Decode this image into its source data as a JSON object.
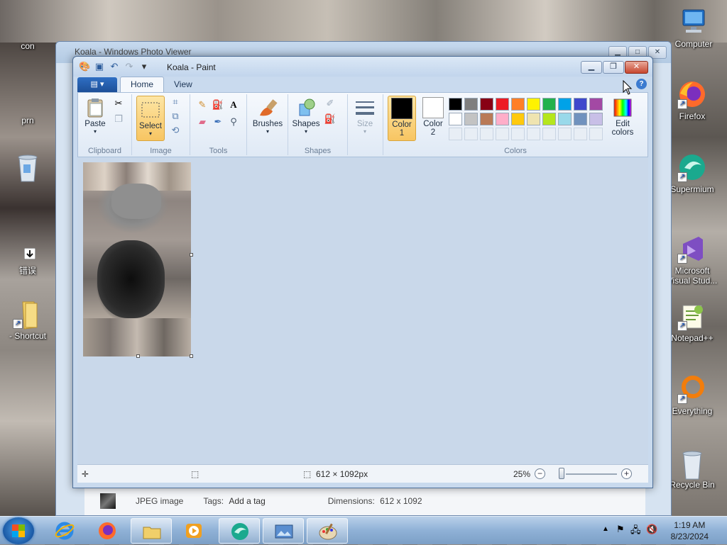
{
  "desktop": {
    "icons_left": [
      {
        "label": "con"
      },
      {
        "label": "prn"
      },
      {
        "label": ""
      },
      {
        "label": "错误"
      },
      {
        "label": "- Shortcut"
      }
    ],
    "icons_right": [
      {
        "label": "Computer"
      },
      {
        "label": "Firefox"
      },
      {
        "label": "Supermium"
      },
      {
        "label": "Microsoft Visual Stud..."
      },
      {
        "label": "Notepad++"
      },
      {
        "label": "Everything"
      },
      {
        "label": "Recycle Bin"
      }
    ]
  },
  "photo_viewer": {
    "title": "Koala - Windows Photo Viewer",
    "file_type": "JPEG image",
    "tags_label": "Tags:",
    "tags_value": "Add a tag",
    "dimensions_label": "Dimensions:",
    "dimensions_value": "612 x 1092"
  },
  "paint": {
    "title": "Koala - Paint",
    "tabs": [
      "Home",
      "View"
    ],
    "groups": {
      "clipboard": {
        "label": "Clipboard",
        "paste": "Paste"
      },
      "image": {
        "label": "Image",
        "select": "Select"
      },
      "tools": {
        "label": "Tools"
      },
      "brushes": "Brushes",
      "shapes": {
        "label": "Shapes",
        "button": "Shapes"
      },
      "size": "Size",
      "colors": {
        "label": "Colors",
        "color1": "Color",
        "color1_num": "1",
        "color2": "Color",
        "color2_num": "2",
        "edit": "Edit",
        "edit2": "colors",
        "primary": "#000000",
        "secondary": "#ffffff",
        "palette_row1": [
          "#000000",
          "#7f7f7f",
          "#880015",
          "#ed1c24",
          "#ff7f27",
          "#fff200",
          "#22b14c",
          "#00a2e8",
          "#3f48cc",
          "#a349a4"
        ],
        "palette_row2": [
          "#ffffff",
          "#c3c3c3",
          "#b97a57",
          "#ffaec9",
          "#ffc90e",
          "#efe4b0",
          "#b5e61d",
          "#99d9ea",
          "#7092be",
          "#c8bfe7"
        ]
      }
    },
    "status": {
      "dimensions": "612 × 1092px",
      "zoom": "25%"
    }
  },
  "taskbar": {
    "time": "1:19 AM",
    "date": "8/23/2024"
  }
}
